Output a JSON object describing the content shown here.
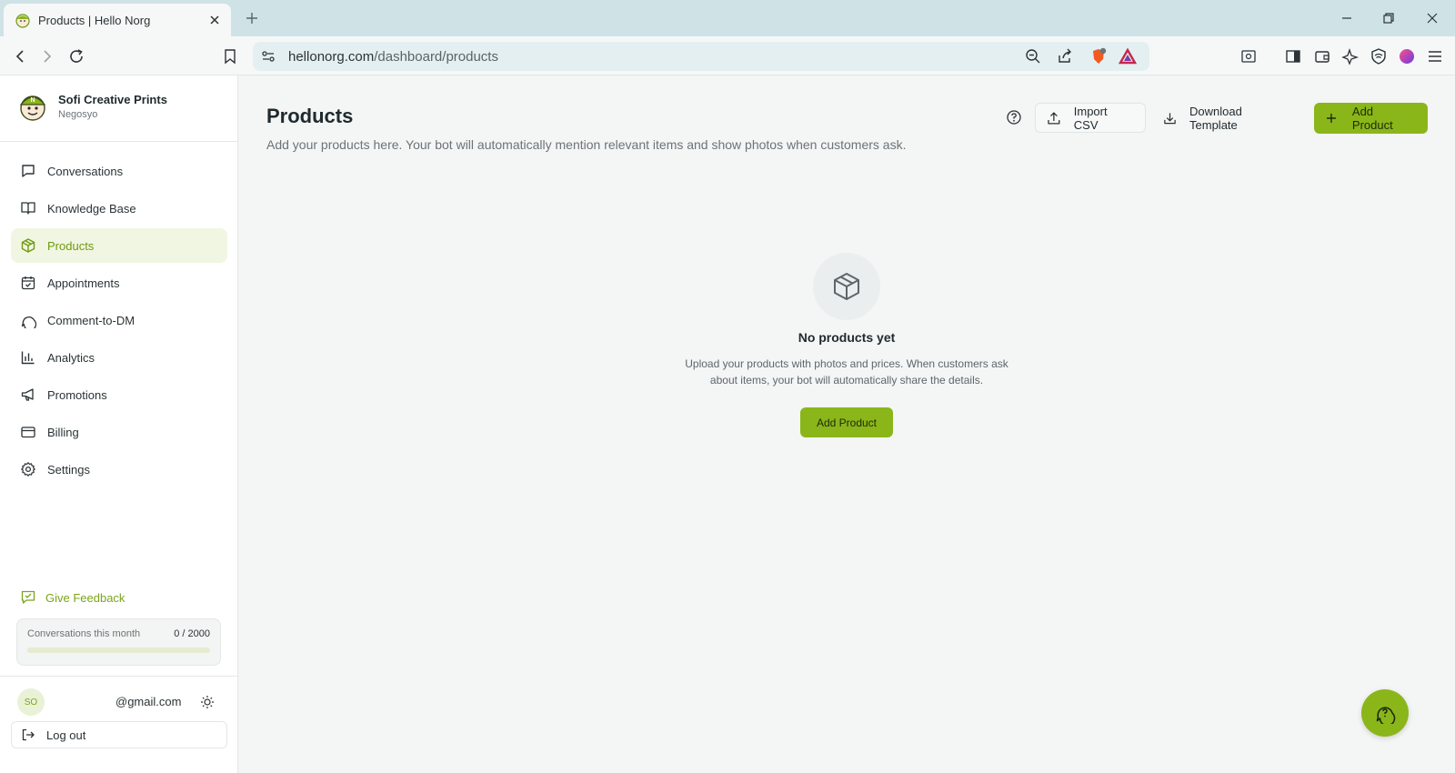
{
  "browser": {
    "tab_title": "Products | Hello Norg",
    "url_host": "hellonorg.com",
    "url_path": "/dashboard/products"
  },
  "sidebar": {
    "brand_name": "Sofi Creative Prints",
    "brand_sub": "Negosyo",
    "items": [
      {
        "label": "Conversations",
        "icon": "chat-bubble-icon",
        "active": false
      },
      {
        "label": "Knowledge Base",
        "icon": "book-icon",
        "active": false
      },
      {
        "label": "Products",
        "icon": "package-icon",
        "active": true
      },
      {
        "label": "Appointments",
        "icon": "calendar-icon",
        "active": false
      },
      {
        "label": "Comment-to-DM",
        "icon": "message-circle-icon",
        "active": false
      },
      {
        "label": "Analytics",
        "icon": "bar-chart-icon",
        "active": false
      },
      {
        "label": "Promotions",
        "icon": "megaphone-icon",
        "active": false
      },
      {
        "label": "Billing",
        "icon": "credit-card-icon",
        "active": false
      },
      {
        "label": "Settings",
        "icon": "gear-icon",
        "active": false
      }
    ],
    "feedback_label": "Give Feedback",
    "usage": {
      "label": "Conversations this month",
      "count": "0 / 2000",
      "used": 0,
      "limit": 2000
    },
    "user": {
      "initials": "SO",
      "email": "@gmail.com"
    },
    "logout_label": "Log out"
  },
  "main": {
    "title": "Products",
    "description": "Add your products here. Your bot will automatically mention relevant items and show photos when customers ask.",
    "import_label": "Import CSV",
    "download_label": "Download Template",
    "add_label": "Add Product",
    "empty": {
      "title": "No products yet",
      "line1": "Upload your products with photos and prices. When customers ask",
      "line2": "about items, your bot will automatically share the details.",
      "button_label": "Add Product"
    }
  },
  "colors": {
    "accent": "#8ab61a",
    "accent_text": "#6f9a12",
    "active_bg": "#f0f6e1"
  }
}
